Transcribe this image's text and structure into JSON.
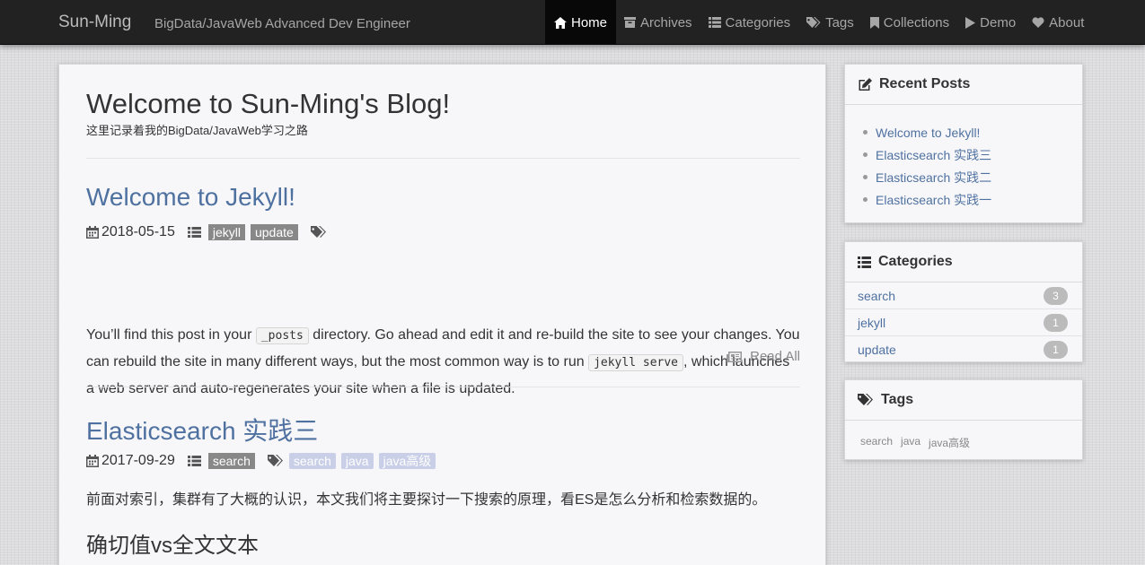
{
  "nav": {
    "brand": "Sun-Ming",
    "tagline": "BigData/JavaWeb Advanced Dev Engineer",
    "items": [
      {
        "label": "Home",
        "icon": "home-icon",
        "active": true
      },
      {
        "label": "Archives",
        "icon": "archive-icon"
      },
      {
        "label": "Categories",
        "icon": "list-icon"
      },
      {
        "label": "Tags",
        "icon": "tags-icon"
      },
      {
        "label": "Collections",
        "icon": "bookmark-icon"
      },
      {
        "label": "Demo",
        "icon": "play-icon"
      },
      {
        "label": "About",
        "icon": "heart-icon"
      }
    ]
  },
  "header": {
    "title": "Welcome to Sun-Ming's Blog!",
    "subtitle": "这里记录着我的BigData/JavaWeb学习之路"
  },
  "posts": [
    {
      "title": "Welcome to Jekyll!",
      "date": "2018-05-15",
      "categories": [
        "jekyll",
        "update"
      ],
      "tags": [],
      "excerpt": {
        "p1": "You’ll find this post in your ",
        "code1": "_posts",
        "p2": " directory. Go ahead and edit it and re-build the site to see your changes. You can rebuild the site in many different ways, but the most common way is to run ",
        "code2": "jekyll serve",
        "p3": ", which launches a web server and auto-regenerates your site when a file is updated."
      },
      "read_all": "Read All"
    },
    {
      "title": "Elasticsearch 实践三",
      "date": "2017-09-29",
      "categories": [
        "search"
      ],
      "tags": [
        "search",
        "java",
        "java高级"
      ],
      "excerpt": "前面对索引，集群有了大概的认识，本文我们将主要探讨一下搜索的原理，看ES是怎么分析和检索数据的。",
      "heading": "确切值vs全文文本"
    }
  ],
  "sidebar": {
    "recent": {
      "title": "Recent Posts",
      "items": [
        "Welcome to Jekyll!",
        "Elasticsearch 实践三",
        "Elasticsearch 实践二",
        "Elasticsearch 实践一"
      ]
    },
    "categories": {
      "title": "Categories",
      "items": [
        {
          "name": "search",
          "count": "3"
        },
        {
          "name": "jekyll",
          "count": "1"
        },
        {
          "name": "update",
          "count": "1"
        }
      ]
    },
    "tags": {
      "title": "Tags",
      "items": [
        "search",
        "java",
        "java高级"
      ]
    }
  },
  "colors": {
    "link": "#4f71a0",
    "navbar": "#222222",
    "active_nav": "#080808",
    "label_dark": "#888888",
    "label_light": "#c9cfe6"
  }
}
